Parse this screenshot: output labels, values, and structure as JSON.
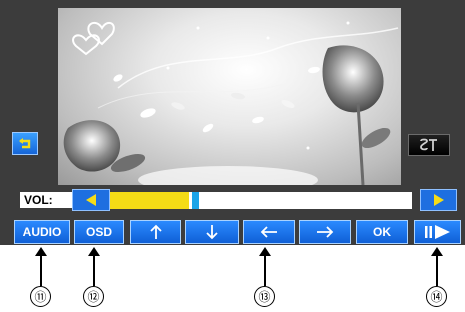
{
  "volume": {
    "label": "VOL:",
    "level_fraction": 0.26
  },
  "controls": {
    "audio": "AUDIO",
    "osd": "OSD",
    "up_icon": "up-arrow-icon",
    "down_icon": "down-arrow-icon",
    "left_icon": "left-arrow-icon",
    "right_icon": "right-arrow-icon",
    "ok": "OK",
    "play_pause_icon": "play-pause-icon"
  },
  "side_buttons": {
    "repeat_icon": "repeat-icon",
    "subtitle_icon": "subtitle-icon"
  },
  "callouts": [
    "⑪",
    "⑫",
    "⑬",
    "⑭"
  ],
  "colors": {
    "panel": "#3c3c3c",
    "button_blue": "#1e6fe0",
    "volume_fill": "#f4dc16",
    "knob": "#1ba4e8"
  }
}
